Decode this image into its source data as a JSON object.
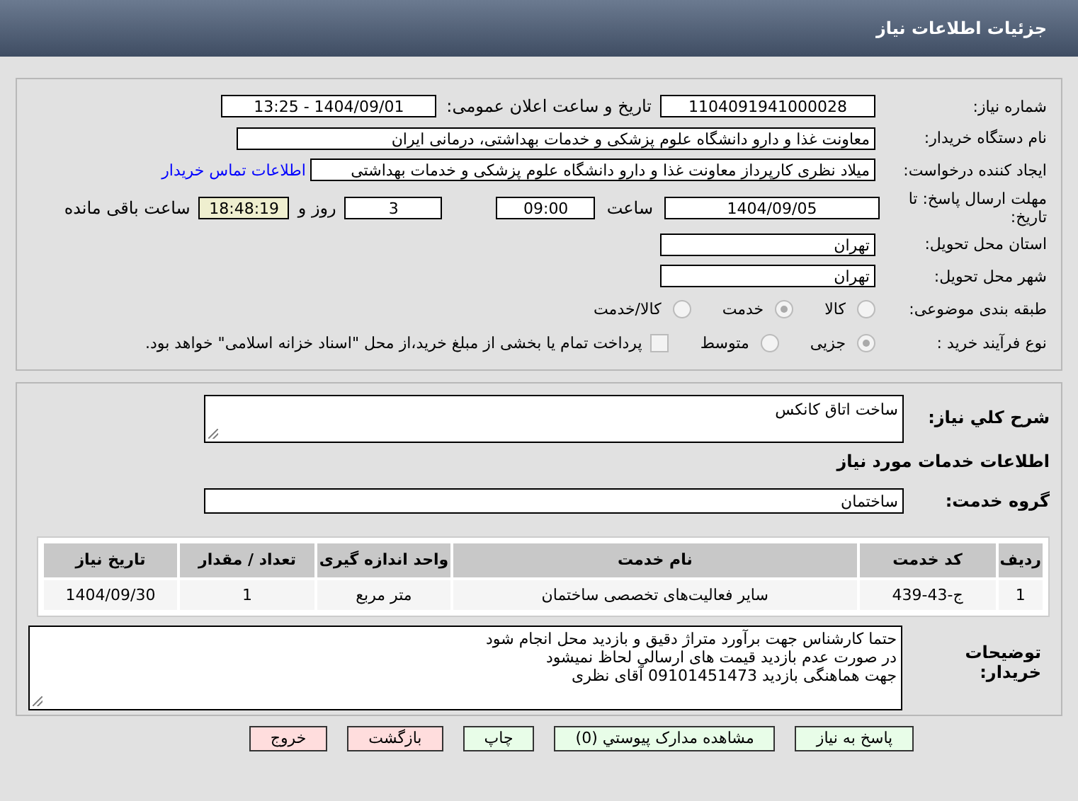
{
  "header": {
    "title": "جزئیات اطلاعات نیاز"
  },
  "info": {
    "need_number": {
      "label": "شماره نیاز:",
      "value": "1104091941000028"
    },
    "announce": {
      "label": "تاریخ و ساعت اعلان عمومی:",
      "value": "1404/09/01 - 13:25"
    },
    "buyer": {
      "label": "نام دستگاه خریدار:",
      "value": "معاونت غذا و دارو دانشگاه علوم پزشکی و خدمات بهداشتی، درمانی ایران"
    },
    "creator": {
      "label": "ایجاد کننده درخواست:",
      "value": "میلاد نظری کارپرداز معاونت غذا و دارو دانشگاه علوم پزشکی و خدمات بهداشتی",
      "link": "اطلاعات تماس خریدار"
    },
    "deadline": {
      "label": "مهلت ارسال پاسخ: تا تاریخ:",
      "date": "1404/09/05",
      "time_label": "ساعت",
      "time": "09:00",
      "days": "3",
      "days_label": "روز و",
      "remaining": "18:48:19",
      "remaining_label": "ساعت باقی مانده"
    },
    "province": {
      "label": "استان محل تحویل:",
      "value": "تهران"
    },
    "city": {
      "label": "شهر محل تحویل:",
      "value": "تهران"
    },
    "category": {
      "label": "طبقه بندی موضوعی:",
      "options": [
        {
          "label": "کالا",
          "selected": false
        },
        {
          "label": "خدمت",
          "selected": true
        },
        {
          "label": "کالا/خدمت",
          "selected": false
        }
      ]
    },
    "process": {
      "label": "نوع فرآیند خرید :",
      "options": [
        {
          "label": "جزیی",
          "selected": true
        },
        {
          "label": "متوسط",
          "selected": false
        }
      ],
      "payment": {
        "label": "پرداخت تمام یا بخشی از مبلغ خرید،از محل \"اسناد خزانه اسلامی\" خواهد بود.",
        "checked": false
      }
    }
  },
  "details": {
    "summary": {
      "label": "شرح کلي نیاز:",
      "value": "ساخت اتاق کانکس"
    },
    "section_title": "اطلاعات خدمات مورد نیاز",
    "service_group": {
      "label": "گروه خدمت:",
      "value": "ساختمان"
    },
    "table": {
      "columns": [
        "ردیف",
        "کد خدمت",
        "نام خدمت",
        "واحد اندازه گیری",
        "تعداد / مقدار",
        "تاریخ نیاز"
      ],
      "rows": [
        [
          "1",
          "ج-43-439",
          "سایر فعالیت‌های تخصصی ساختمان",
          "متر مربع",
          "1",
          "1404/09/30"
        ]
      ]
    },
    "notes": {
      "label": "توضیحات خریدار:",
      "value": "حتما کارشناس جهت برآورد متراژ دقیق و بازدید محل انجام شود\nدر صورت عدم بازدید قیمت های ارسالي لحاظ نميشود\nجهت هماهنگی بازدید 09101451473 آقای نظری"
    }
  },
  "buttons": [
    {
      "label": "پاسخ به نیاز",
      "kind": "normal"
    },
    {
      "label": "مشاهده مدارک پیوستي (0)",
      "kind": "normal"
    },
    {
      "label": "چاپ",
      "kind": "normal"
    },
    {
      "label": "بازگشت",
      "kind": "exit"
    },
    {
      "label": "خروج",
      "kind": "exit"
    }
  ]
}
